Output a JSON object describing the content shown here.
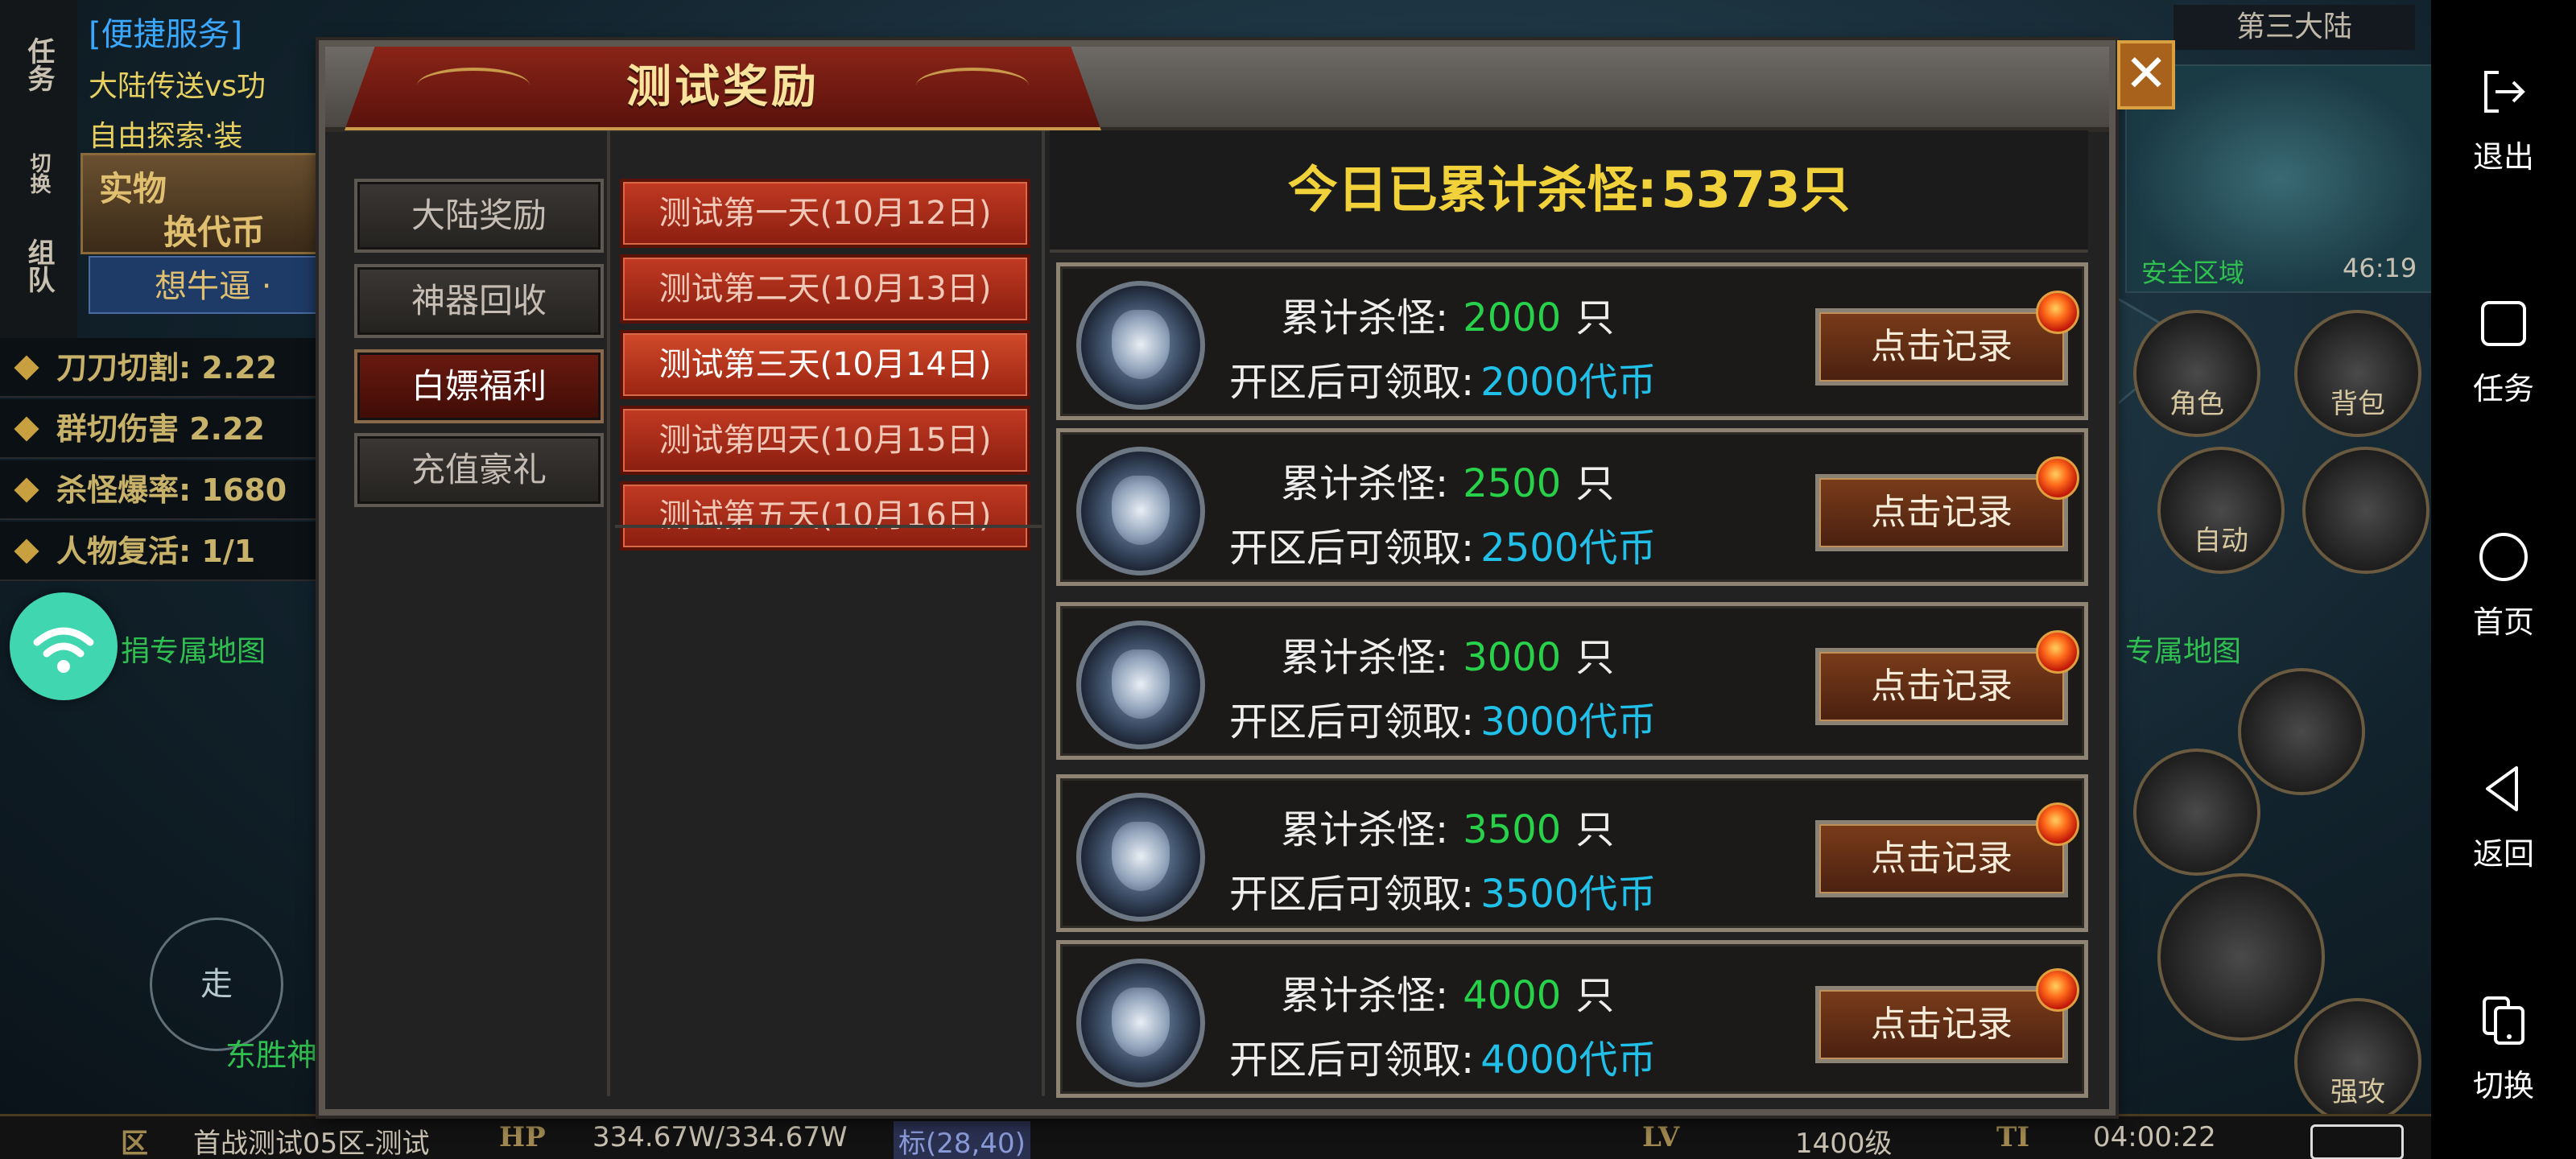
{
  "game": {
    "quick_service": {
      "title": "[便捷服务]",
      "line1": "大陆传送vs功",
      "line2": "自由探索·装"
    },
    "left_rail": [
      "任务",
      "切换",
      "组队"
    ],
    "shiwu_button": {
      "line1": "实物",
      "line2": "换代币"
    },
    "think_button": "想牛逼 ·",
    "stats": [
      "刀刀切割: 2.22",
      "群切伤害 2.22",
      "杀怪爆率: 1680",
      "人物复活: 1/1"
    ],
    "map_label_left": "捐专属地图",
    "map_label_right": "专属地图",
    "walk_button": "走",
    "bottom_green_label": "东胜神",
    "top_right_label": "第三大陆",
    "safe_zone": "安全区域",
    "clock_short": "46:19",
    "round_buttons": [
      "角色",
      "背包",
      "自动",
      "",
      "",
      "强攻"
    ],
    "bottom_bar": {
      "zone_tag": "区",
      "server_name": "首战测试05区-测试",
      "hp_tag": "HP",
      "hp_value": "334.67W/334.67W",
      "coords": "标(28,40)",
      "lv_tag": "LV",
      "level": "1400级",
      "ti_tag": "TI",
      "time": "04:00:22"
    }
  },
  "dialog": {
    "title": "测试奖励",
    "close_symbol": "✕",
    "categories": [
      {
        "label": "大陆奖励",
        "active": false
      },
      {
        "label": "神器回收",
        "active": false
      },
      {
        "label": "白嫖福利",
        "active": true
      },
      {
        "label": "充值豪礼",
        "active": false
      }
    ],
    "days": [
      {
        "label": "测试第一天(10月12日)",
        "active": false
      },
      {
        "label": "测试第二天(10月13日)",
        "active": false
      },
      {
        "label": "测试第三天(10月14日)",
        "active": true
      },
      {
        "label": "测试第四天(10月15日)",
        "active": false
      },
      {
        "label": "测试第五天(10月16日)",
        "active": false
      }
    ],
    "kill_label": "今日已累计杀怪:",
    "kill_count": "5373只",
    "rewards": [
      {
        "kill_label": "累计杀怪:",
        "kill_target": "2000",
        "unit": "只",
        "claim_label": "开区后可领取:",
        "reward": "2000代币",
        "button": "点击记录"
      },
      {
        "kill_label": "累计杀怪:",
        "kill_target": "2500",
        "unit": "只",
        "claim_label": "开区后可领取:",
        "reward": "2500代币",
        "button": "点击记录"
      },
      {
        "kill_label": "累计杀怪:",
        "kill_target": "3000",
        "unit": "只",
        "claim_label": "开区后可领取:",
        "reward": "3000代币",
        "button": "点击记录"
      },
      {
        "kill_label": "累计杀怪:",
        "kill_target": "3500",
        "unit": "只",
        "claim_label": "开区后可领取:",
        "reward": "3500代币",
        "button": "点击记录"
      },
      {
        "kill_label": "累计杀怪:",
        "kill_target": "4000",
        "unit": "只",
        "claim_label": "开区后可领取:",
        "reward": "4000代币",
        "button": "点击记录"
      }
    ]
  },
  "android_nav": [
    {
      "label": "退出",
      "icon": "exit-icon"
    },
    {
      "label": "任务",
      "icon": "square-icon"
    },
    {
      "label": "首页",
      "icon": "circle-icon"
    },
    {
      "label": "返回",
      "icon": "back-triangle-icon"
    },
    {
      "label": "切换",
      "icon": "switch-icon"
    }
  ],
  "colors": {
    "dialog_title": "#f7e39b",
    "kill_banner": "#f2d23a",
    "kill_target": "#27d24a",
    "reward_value": "#20c0e8",
    "active_tab": "#7a1a10",
    "day_tab": "#c23a22",
    "close_button": "#a8621c"
  }
}
